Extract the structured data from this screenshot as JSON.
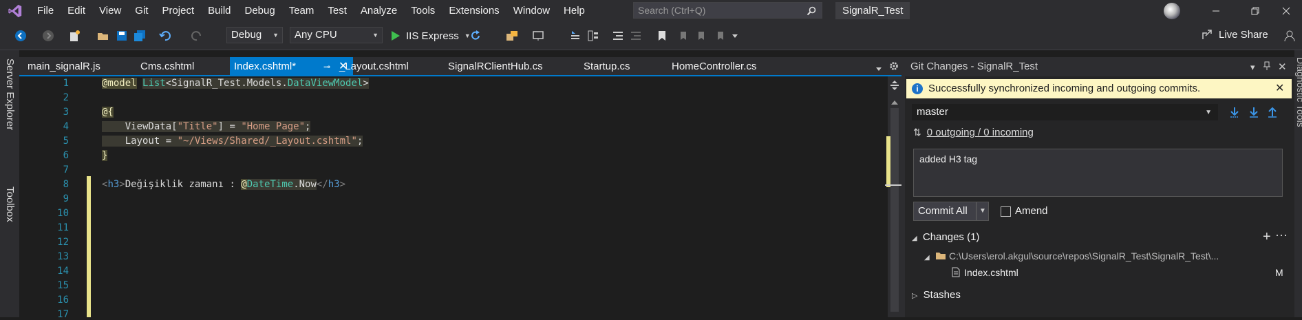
{
  "menu": {
    "items": [
      "File",
      "Edit",
      "View",
      "Git",
      "Project",
      "Build",
      "Debug",
      "Team",
      "Test",
      "Analyze",
      "Tools",
      "Extensions",
      "Window",
      "Help"
    ],
    "search_placeholder": "Search (Ctrl+Q)",
    "solution_name": "SignalR_Test"
  },
  "toolbar": {
    "config": "Debug",
    "platform": "Any CPU",
    "run_target": "IIS Express",
    "live_share": "Live Share"
  },
  "left_strip": {
    "server_explorer": "Server Explorer",
    "toolbox": "Toolbox"
  },
  "right_strip": {
    "diagnostic_tools": "Diagnostic Tools"
  },
  "tabs": [
    {
      "label": "main_signalR.js"
    },
    {
      "label": "Cms.cshtml"
    },
    {
      "label": "Index.cshtml*"
    },
    {
      "label": "_Layout.cshtml"
    },
    {
      "label": "SignalRClientHub.cs"
    },
    {
      "label": "Startup.cs"
    },
    {
      "label": "HomeController.cs"
    }
  ],
  "editor": {
    "line_numbers": [
      "1",
      "2",
      "3",
      "4",
      "5",
      "6",
      "7",
      "8",
      "9",
      "10",
      "11",
      "12",
      "13",
      "14",
      "15",
      "16",
      "17"
    ],
    "lines": {
      "l1_model": "@model",
      "l1_list": "List",
      "l1_lt": "<",
      "l1_type": "SignalR_Test.Models.",
      "l1_dvm": "DataViewModel",
      "l1_gt": ">",
      "l3": "@{",
      "l4_a": "ViewData[",
      "l4_b": "\"Title\"",
      "l4_c": "] = ",
      "l4_d": "\"Home Page\"",
      "l4_e": ";",
      "l5_a": "Layout = ",
      "l5_b": "\"~/Views/Shared/_Layout.cshtml\"",
      "l5_c": ";",
      "l6": "}",
      "l8_open": "<",
      "l8_h3": "h3",
      "l8_close": ">",
      "l8_text": "Değişiklik zamanı : ",
      "l8_at": "@",
      "l8_dt": "DateTime",
      "l8_now": ".Now",
      "l8_end_lt": "</",
      "l8_end_h3": "h3",
      "l8_end_gt": ">"
    }
  },
  "git_panel": {
    "title": "Git Changes - SignalR_Test",
    "info_message": "Successfully synchronized incoming and outgoing commits.",
    "branch": "master",
    "sync_status": "0 outgoing / 0 incoming",
    "commit_message": "added H3 tag",
    "commit_button": "Commit All",
    "amend_label": "Amend",
    "changes_header": "Changes (1)",
    "folder_path": "C:\\Users\\erol.akgul\\source\\repos\\SignalR_Test\\SignalR_Test\\...",
    "file_name": "Index.cshtml",
    "file_status": "M",
    "stashes_label": "Stashes"
  },
  "colors": {
    "accent": "#007acc",
    "info_bar": "#fdf6c3",
    "change_marker": "#e8e28a"
  }
}
